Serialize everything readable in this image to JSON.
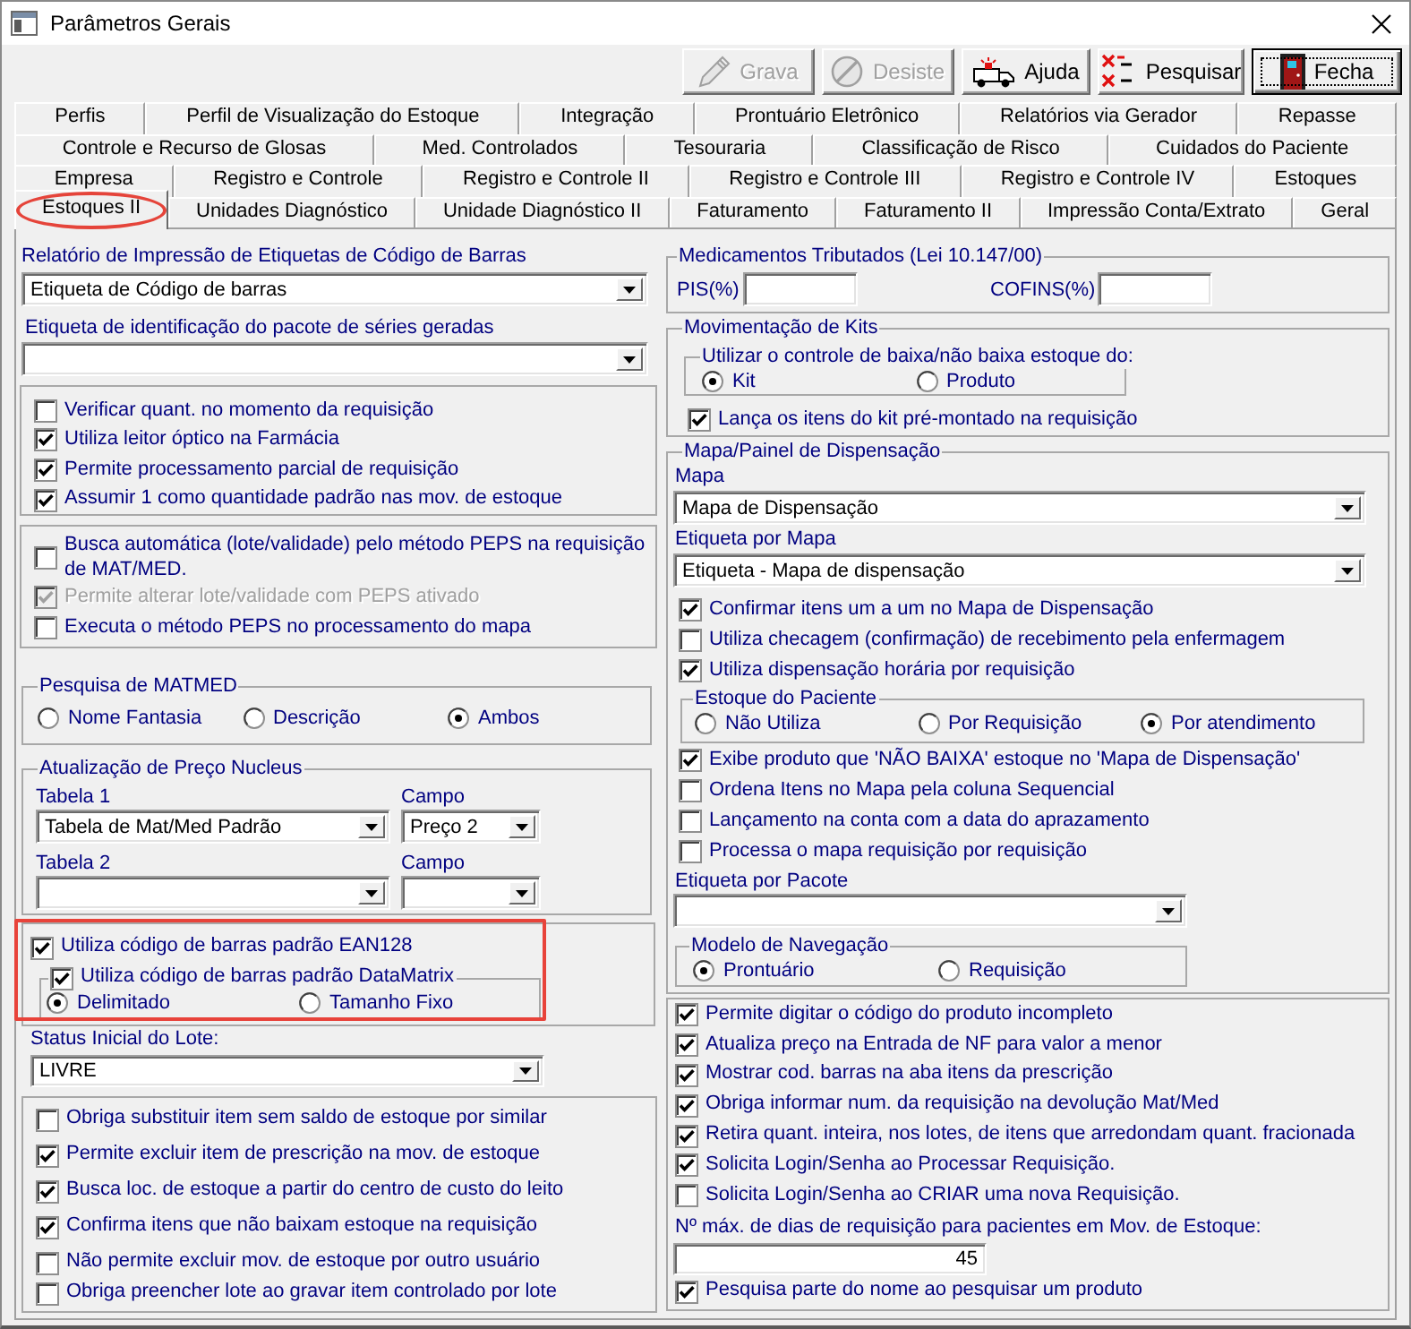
{
  "window": {
    "title": "Parâmetros Gerais"
  },
  "toolbar": [
    {
      "kind": "save",
      "label": "Grava",
      "disabled": true,
      "focused": false
    },
    {
      "kind": "cancel",
      "label": "Desiste",
      "disabled": true,
      "focused": false
    },
    {
      "kind": "help",
      "label": "Ajuda",
      "disabled": false,
      "focused": false
    },
    {
      "kind": "search",
      "label": "Pesquisar",
      "disabled": false,
      "focused": false
    },
    {
      "kind": "exit",
      "label": "Fecha",
      "disabled": false,
      "focused": true
    }
  ],
  "tabs": [
    [
      {
        "label": "Perfis",
        "selected": false,
        "highlighted": false
      },
      {
        "label": "Perfil de Visualização do Estoque",
        "selected": false,
        "highlighted": false
      },
      {
        "label": "Integração",
        "selected": false,
        "highlighted": false
      },
      {
        "label": "Prontuário Eletrônico",
        "selected": false,
        "highlighted": false
      },
      {
        "label": "Relatórios via Gerador",
        "selected": false,
        "highlighted": false
      },
      {
        "label": "Repasse",
        "selected": false,
        "highlighted": false
      }
    ],
    [
      {
        "label": "Controle e Recurso de Glosas",
        "selected": false,
        "highlighted": false
      },
      {
        "label": "Med. Controlados",
        "selected": false,
        "highlighted": false
      },
      {
        "label": "Tesouraria",
        "selected": false,
        "highlighted": false
      },
      {
        "label": "Classificação de Risco",
        "selected": false,
        "highlighted": false
      },
      {
        "label": "Cuidados do Paciente",
        "selected": false,
        "highlighted": false
      }
    ],
    [
      {
        "label": "Empresa",
        "selected": false,
        "highlighted": false
      },
      {
        "label": "Registro e Controle",
        "selected": false,
        "highlighted": false
      },
      {
        "label": "Registro e Controle II",
        "selected": false,
        "highlighted": false
      },
      {
        "label": "Registro e Controle III",
        "selected": false,
        "highlighted": false
      },
      {
        "label": "Registro e Controle IV",
        "selected": false,
        "highlighted": false
      },
      {
        "label": "Estoques",
        "selected": false,
        "highlighted": false
      }
    ],
    [
      {
        "label": "Estoques II",
        "selected": true,
        "highlighted": true
      },
      {
        "label": "Unidades Diagnóstico",
        "selected": false,
        "highlighted": false
      },
      {
        "label": "Unidade Diagnóstico II",
        "selected": false,
        "highlighted": false
      },
      {
        "label": "Faturamento",
        "selected": false,
        "highlighted": false
      },
      {
        "label": "Faturamento II",
        "selected": false,
        "highlighted": false
      },
      {
        "label": "Impressão Conta/Extrato",
        "selected": false,
        "highlighted": false
      },
      {
        "label": "Geral",
        "selected": false,
        "highlighted": false
      }
    ]
  ],
  "left": {
    "barcode_report": {
      "label": "Relatório de Impressão de Etiquetas de Código de Barras",
      "value": "Etiqueta de Código de barras"
    },
    "series_label": {
      "label": "Etiqueta de identificação do pacote de séries geradas"
    },
    "requisition_options": [
      {
        "label": "Verificar quant. no momento da requisição",
        "checked": false
      },
      {
        "label": "Utiliza leitor óptico na Farmácia",
        "checked": true
      },
      {
        "label": "Permite processamento parcial de requisição",
        "checked": true
      },
      {
        "label": "Assumir 1 como quantidade padrão nas mov. de estoque",
        "checked": true
      }
    ],
    "peps_options": [
      {
        "label": "Busca automática (lote/validade) pelo método PEPS na requisição de MAT/MED.",
        "checked": false,
        "disabled": false
      },
      {
        "label": "Permite alterar lote/validade com PEPS ativado",
        "checked": true,
        "disabled": true
      },
      {
        "label": "Executa o método PEPS no processamento do mapa",
        "checked": false,
        "disabled": false
      }
    ],
    "matmed_search": {
      "title": "Pesquisa de MATMED",
      "options": [
        {
          "label": "Nome Fantasia",
          "selected": false
        },
        {
          "label": "Descrição",
          "selected": false
        },
        {
          "label": "Ambos",
          "selected": true
        }
      ]
    },
    "price_update": {
      "title": "Atualização de Preço Nucleus",
      "table_1": {
        "label": "Tabela 1",
        "value": "Tabela de Mat/Med Padrão"
      },
      "field_1": {
        "label": "Campo",
        "value": "Preço 2"
      },
      "table_2": {
        "label": "Tabela 2"
      },
      "field_2": {
        "label": "Campo"
      }
    },
    "barcode": {
      "highlighted": true,
      "ean128": {
        "label": "Utiliza código de barras padrão EAN128",
        "checked": true
      },
      "datamatrix": {
        "label": "Utiliza código de barras padrão DataMatrix",
        "checked": true,
        "options": [
          {
            "label": "Delimitado",
            "selected": true
          },
          {
            "label": "Tamanho Fixo",
            "selected": false
          }
        ]
      }
    },
    "lot_status": {
      "label": "Status Inicial do Lote:",
      "value": "LIVRE"
    },
    "stock_options": [
      {
        "label": "Obriga substituir item sem saldo de estoque por similar",
        "checked": false
      },
      {
        "label": "Permite excluir item de prescrição na mov. de estoque",
        "checked": true
      },
      {
        "label": "Busca loc. de estoque a partir do centro de custo do leito",
        "checked": true
      },
      {
        "label": "Confirma itens que não baixam estoque na requisição",
        "checked": true
      },
      {
        "label": "Não permite excluir mov. de estoque por outro usuário",
        "checked": false
      },
      {
        "label": "Obriga preencher lote ao gravar item controlado por lote",
        "checked": false
      }
    ]
  },
  "right": {
    "taxed_drugs": {
      "title": "Medicamentos Tributados (Lei 10.147/00)",
      "fields": [
        {
          "label": "PIS(%)"
        },
        {
          "label": "COFINS(%)"
        }
      ]
    },
    "kits": {
      "title": "Movimentação de Kits",
      "control": {
        "title": "Utilizar o controle de baixa/não baixa estoque do:",
        "options": [
          {
            "label": "Kit",
            "selected": true
          },
          {
            "label": "Produto",
            "selected": false
          }
        ]
      },
      "options": [
        {
          "label": "Lança os itens do kit pré-montado na requisição",
          "checked": true
        }
      ]
    },
    "dispensing": {
      "title": "Mapa/Painel de Dispensação",
      "map": {
        "label": "Mapa",
        "value": "Mapa de Dispensação"
      },
      "map_label": {
        "label": "Etiqueta por Mapa",
        "value": "Etiqueta - Mapa de dispensação"
      },
      "options_1": [
        {
          "label": "Confirmar itens um a um no Mapa de Dispensação",
          "checked": true
        },
        {
          "label": "Utiliza checagem (confirmação) de recebimento pela enfermagem",
          "checked": false
        },
        {
          "label": "Utiliza dispensação horária por requisição",
          "checked": true
        }
      ],
      "patient_stock": {
        "title": "Estoque do Paciente",
        "options": [
          {
            "label": "Não Utiliza",
            "selected": false
          },
          {
            "label": "Por Requisição",
            "selected": false
          },
          {
            "label": "Por atendimento",
            "selected": true
          }
        ]
      },
      "options_2": [
        {
          "label": "Exibe produto que 'NÃO BAIXA' estoque no 'Mapa de Dispensação'",
          "checked": true
        },
        {
          "label": "Ordena Itens no Mapa pela coluna Sequencial",
          "checked": false
        },
        {
          "label": "Lançamento na conta com a data do aprazamento",
          "checked": false
        },
        {
          "label": "Processa o mapa requisição por requisição",
          "checked": false
        }
      ],
      "package_label": {
        "label": "Etiqueta por Pacote"
      },
      "navigation": {
        "title": "Modelo de Navegação",
        "options": [
          {
            "label": "Prontuário",
            "selected": true
          },
          {
            "label": "Requisição",
            "selected": false
          }
        ]
      }
    },
    "general_options": [
      {
        "label": "Permite digitar o código do produto incompleto",
        "checked": true
      },
      {
        "label": "Atualiza preço na Entrada de NF para valor a menor",
        "checked": true
      },
      {
        "label": "Mostrar cod. barras na aba itens da prescrição",
        "checked": true
      },
      {
        "label": "Obriga informar num. da requisição na devolução Mat/Med",
        "checked": true
      },
      {
        "label": "Retira quant. inteira, nos lotes, de itens que arredondam quant. fracionada",
        "checked": true
      },
      {
        "label": "Solicita Login/Senha ao Processar Requisição.",
        "checked": true
      },
      {
        "label": "Solicita Login/Senha ao CRIAR uma nova Requisição.",
        "checked": false
      }
    ],
    "max_days": {
      "label": "Nº máx. de dias de requisição para pacientes em Mov. de Estoque:",
      "value": "45"
    },
    "search_options": [
      {
        "label": "Pesquisa parte do nome ao pesquisar um produto",
        "checked": true
      }
    ]
  }
}
